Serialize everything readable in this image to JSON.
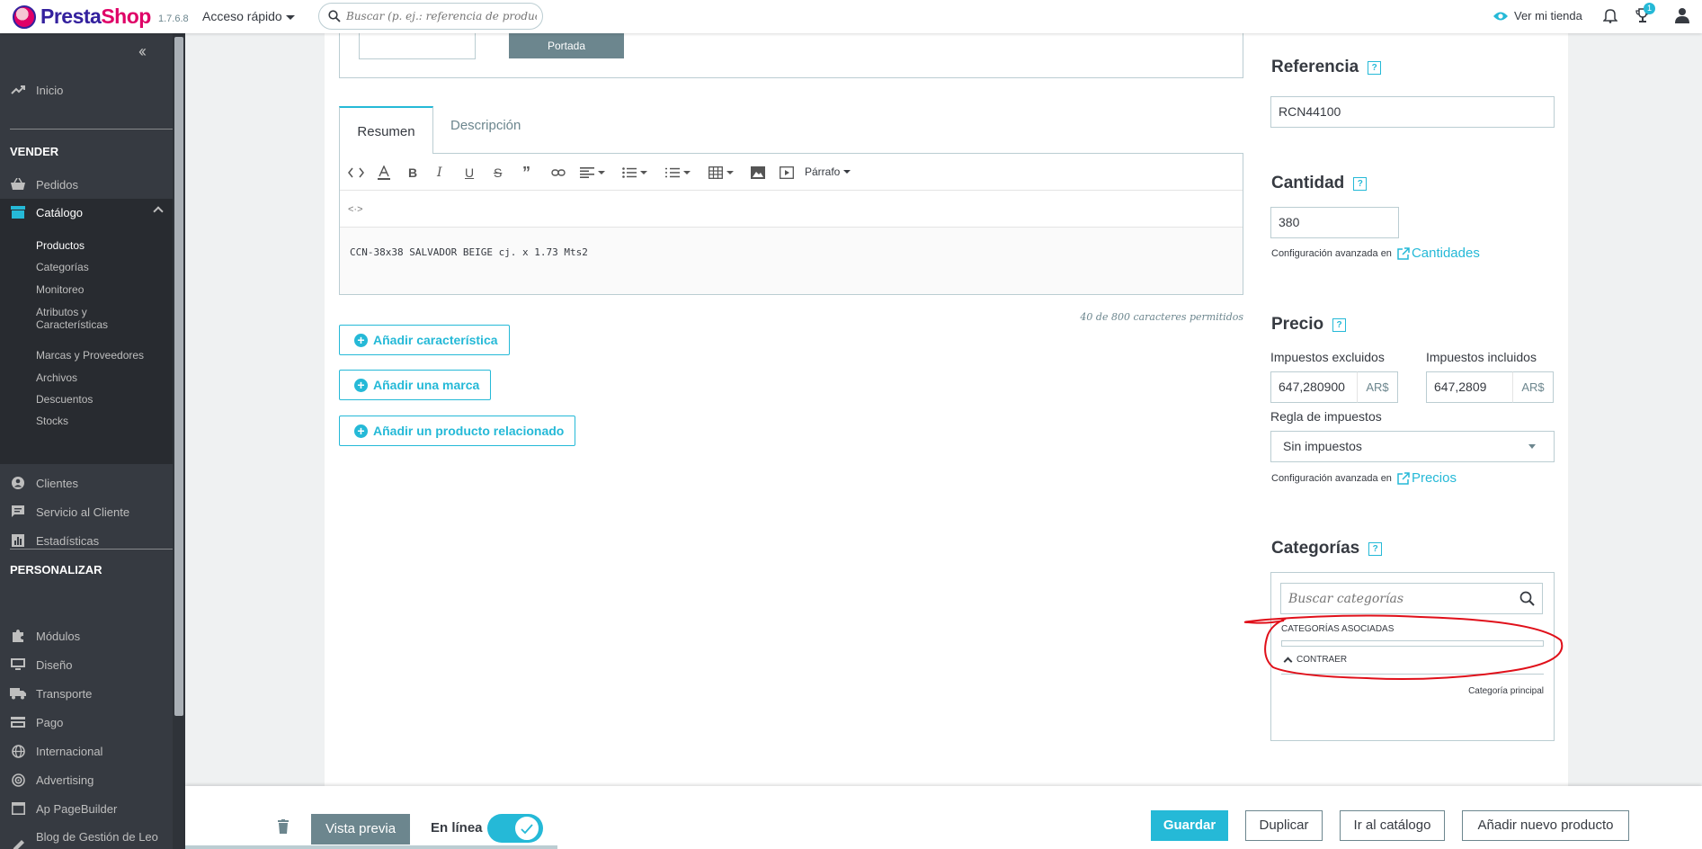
{
  "header": {
    "logo_main": "Presta",
    "logo_accent": "Shop",
    "version": "1.7.6.8",
    "quick_access": "Acceso rápido",
    "search_placeholder": "Buscar (p. ej.: referencia de producto, no",
    "view_store": "Ver mi tienda",
    "notifications_count": "1"
  },
  "sidebar": {
    "inicio": "Inicio",
    "sec_vender": "VENDER",
    "pedidos": "Pedidos",
    "catalogo": "Catálogo",
    "sub": [
      "Productos",
      "Categorías",
      "Monitoreo",
      "Atributos y Características",
      "Marcas y Proveedores",
      "Archivos",
      "Descuentos",
      "Stocks"
    ],
    "clientes": "Clientes",
    "servicio": "Servicio al Cliente",
    "estadisticas": "Estadísticas",
    "sec_personalizar": "PERSONALIZAR",
    "modulos": "Módulos",
    "diseno": "Diseño",
    "transporte": "Transporte",
    "pago": "Pago",
    "internacional": "Internacional",
    "advertising": "Advertising",
    "pagebuilder": "Ap PageBuilder",
    "blog": "Blog de Gestión de Leo"
  },
  "main": {
    "portada": "Portada",
    "tab_resumen": "Resumen",
    "tab_descripcion": "Descripción",
    "paragraph_format": "Párrafo",
    "editor_text": "CCN-38x38 SALVADOR BEIGE cj. x 1.73 Mts2",
    "char_count": "40 de 800 caracteres permitidos",
    "btn_caracteristica": "Añadir característica",
    "btn_marca": "Añadir una marca",
    "btn_relacionado": "Añadir un producto relacionado"
  },
  "right": {
    "referencia_title": "Referencia",
    "referencia_value": "RCN44100",
    "cantidad_title": "Cantidad",
    "cantidad_value": "380",
    "adv_config": "Configuración avanzada en",
    "cantidades_link": "Cantidades",
    "precio_title": "Precio",
    "impuestos_excluidos": "Impuestos excluidos",
    "impuestos_incluidos": "Impuestos incluidos",
    "price_excl": "647,280900",
    "price_incl": "647,2809",
    "currency": "AR$",
    "regla_impuestos": "Regla de impuestos",
    "regla_value": "Sin impuestos",
    "precios_link": "Precios",
    "categorias_title": "Categorías",
    "cat_search_placeholder": "Buscar categorías",
    "cat_asociadas": "CATEGORÍAS ASOCIADAS",
    "contraer": "CONTRAER",
    "categoria_principal": "Categoría principal",
    "help": "?"
  },
  "footer": {
    "vista_previa": "Vista previa",
    "en_linea": "En línea",
    "guardar": "Guardar",
    "duplicar": "Duplicar",
    "ir_catalogo": "Ir al catálogo",
    "nuevo_producto": "Añadir nuevo producto"
  },
  "colors": {
    "accent": "#25b9d7",
    "sidebar": "#363a41",
    "secondary": "#6c868e",
    "annotation": "#e0101a"
  }
}
